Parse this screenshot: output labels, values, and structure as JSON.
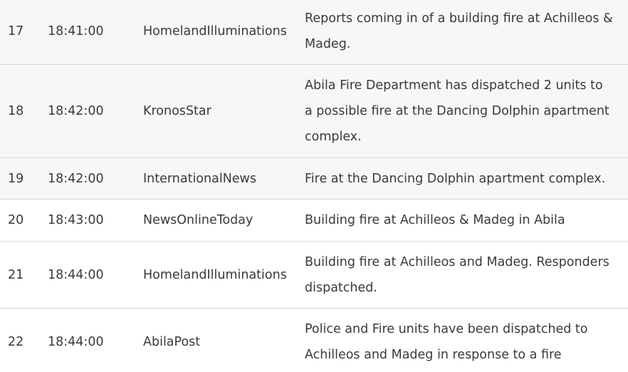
{
  "rows": [
    {
      "num": "17",
      "time": "18:41:00",
      "source": "HomelandIlluminations",
      "message": "Reports coming in of a building fire at Achilleos & Madeg."
    },
    {
      "num": "18",
      "time": "18:42:00",
      "source": "KronosStar",
      "message": "Abila Fire Department has dispatched 2 units to a possible fire at the Dancing Dolphin apartment complex."
    },
    {
      "num": "19",
      "time": "18:42:00",
      "source": "InternationalNews",
      "message": "Fire at the Dancing Dolphin apartment complex."
    },
    {
      "num": "20",
      "time": "18:43:00",
      "source": "NewsOnlineToday",
      "message": "Building fire at Achilleos & Madeg in Abila"
    },
    {
      "num": "21",
      "time": "18:44:00",
      "source": "HomelandIlluminations",
      "message": "Building fire at Achilleos and Madeg. Responders dispatched."
    },
    {
      "num": "22",
      "time": "18:44:00",
      "source": "AbilaPost",
      "message": "Police and Fire units have been dispatched to Achilleos and Madeg in response to a fire"
    }
  ]
}
